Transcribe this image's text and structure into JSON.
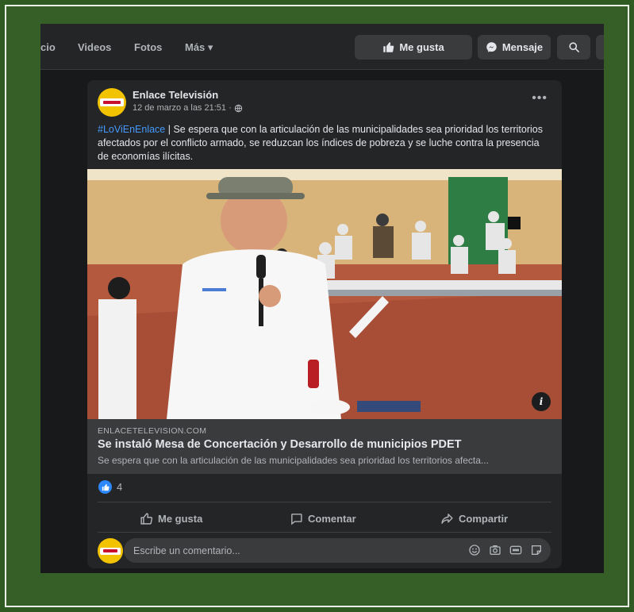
{
  "nav": {
    "tabs": [
      "cio",
      "Videos",
      "Fotos",
      "Más ▾"
    ],
    "like_button": "Me gusta",
    "message_button": "Mensaje"
  },
  "post": {
    "page_name": "Enlace Televisión",
    "timestamp": "12 de marzo a las 21:51 ·",
    "hashtag": "#LoViEnEnlace",
    "text": " | Se espera que con la articulación de las municipalidades sea prioridad los territorios afectados por el conflicto armado, se reduzcan los índices de pobreza y se luche contra la presencia de economías ilícitas.",
    "link": {
      "domain": "ENLACETELEVISION.COM",
      "title": "Se instaló Mesa de Concertación y Desarrollo de municipios PDET",
      "description": "Se espera que con la articulación de las municipalidades sea prioridad los territorios afecta..."
    },
    "reaction_count": "4",
    "actions": {
      "like": "Me gusta",
      "comment": "Comentar",
      "share": "Compartir"
    },
    "comment_placeholder": "Escribe un comentario..."
  },
  "colors": {
    "background_green": "#2f5a22",
    "fb_dark": "#18191a",
    "card": "#242526",
    "link_blue": "#4599ff",
    "like_blue": "#2d88ff"
  }
}
